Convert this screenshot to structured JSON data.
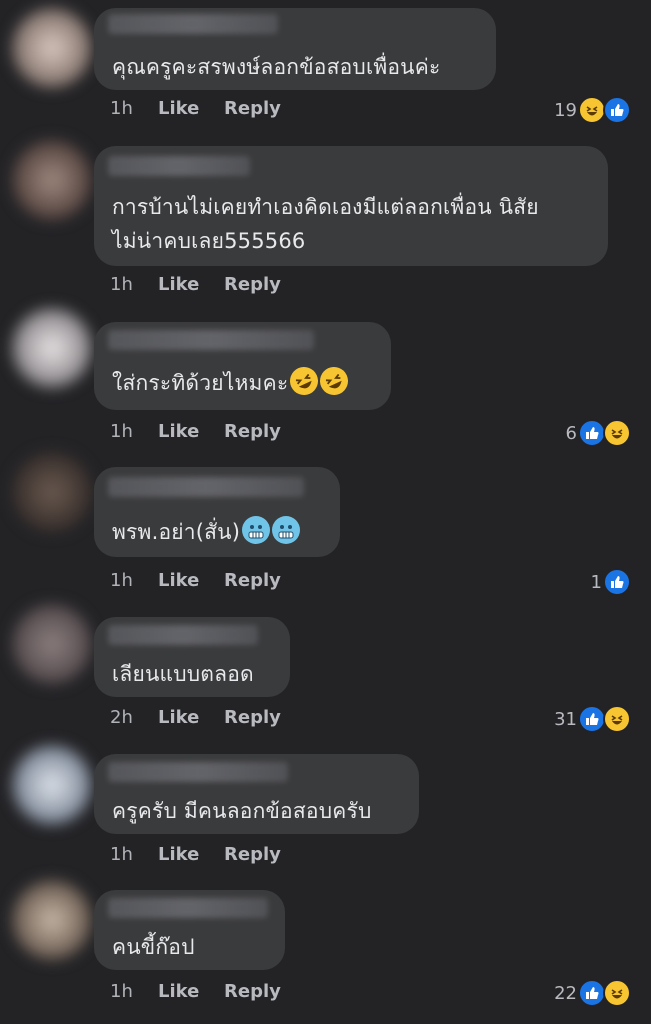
{
  "comments": [
    {
      "text": "คุณครูคะสรพงษ์ลอกข้อสอบเพื่อนค่ะ",
      "time": "1h",
      "like": "Like",
      "reply": "Reply",
      "count": "19",
      "reactions": [
        "haha-icon",
        "like-icon"
      ]
    },
    {
      "text_line1": "การบ้านไม่เคยทำเองคิดเองมีแต่ลอกเพื่อน นิสัย",
      "text_line2": "ไม่น่าคบเลย555566",
      "time": "1h",
      "like": "Like",
      "reply": "Reply"
    },
    {
      "text": "ใส่กระทิด้วยไหมคะ",
      "emojis": [
        "rolling-on-floor-laughing-emoji",
        "rolling-on-floor-laughing-emoji"
      ],
      "time": "1h",
      "like": "Like",
      "reply": "Reply",
      "count": "6",
      "reactions": [
        "like-icon",
        "haha-icon"
      ]
    },
    {
      "text": "พรพ.อย่า(สั่น)",
      "emojis": [
        "cold-face-emoji",
        "cold-face-emoji"
      ],
      "time": "1h",
      "like": "Like",
      "reply": "Reply",
      "count": "1",
      "reactions": [
        "like-icon"
      ]
    },
    {
      "text": "เลียนแบบตลอด",
      "time": "2h",
      "like": "Like",
      "reply": "Reply",
      "count": "31",
      "reactions": [
        "like-icon",
        "haha-icon"
      ]
    },
    {
      "text": "ครูครับ มีคนลอกข้อสอบครับ",
      "time": "1h",
      "like": "Like",
      "reply": "Reply"
    },
    {
      "text": "คนขี้ก๊อป",
      "time": "1h",
      "like": "Like",
      "reply": "Reply",
      "count": "22",
      "reactions": [
        "like-icon",
        "haha-icon"
      ]
    }
  ],
  "colors": {
    "background": "#232326",
    "bubble": "#3a3b3c",
    "like_blue": "#1b74e4",
    "haha_yellow": "#f7c531"
  }
}
